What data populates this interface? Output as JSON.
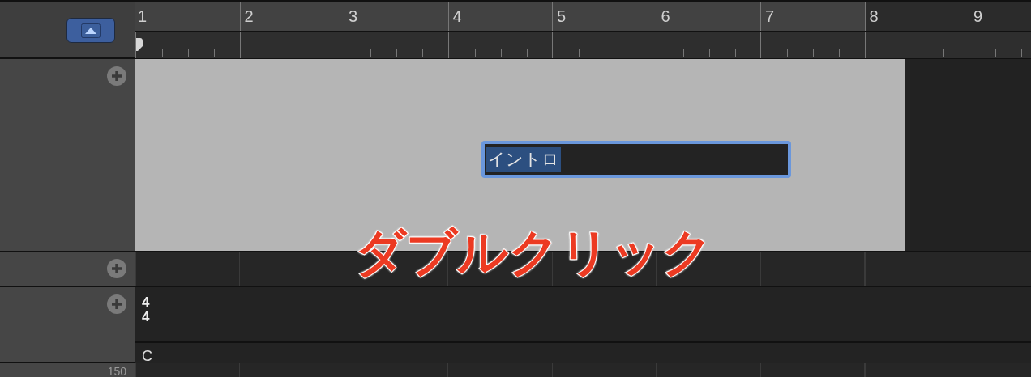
{
  "header": {
    "view_toggle": {
      "selected": true
    }
  },
  "ruler": {
    "bars": [
      {
        "label": "1",
        "in_cycle": true
      },
      {
        "label": "2",
        "in_cycle": true
      },
      {
        "label": "3",
        "in_cycle": true
      },
      {
        "label": "4",
        "in_cycle": true
      },
      {
        "label": "5",
        "in_cycle": true
      },
      {
        "label": "6",
        "in_cycle": true
      },
      {
        "label": "7",
        "in_cycle": true
      },
      {
        "label": "8",
        "in_cycle": false
      },
      {
        "label": "9",
        "in_cycle": false
      }
    ]
  },
  "arrangement": {
    "marker_field": {
      "value": "イントロ",
      "text_selected": true
    }
  },
  "signature": {
    "numerator": "4",
    "denominator": "4"
  },
  "key": "C",
  "tempo": "150",
  "annotation": "ダブルクリック"
}
